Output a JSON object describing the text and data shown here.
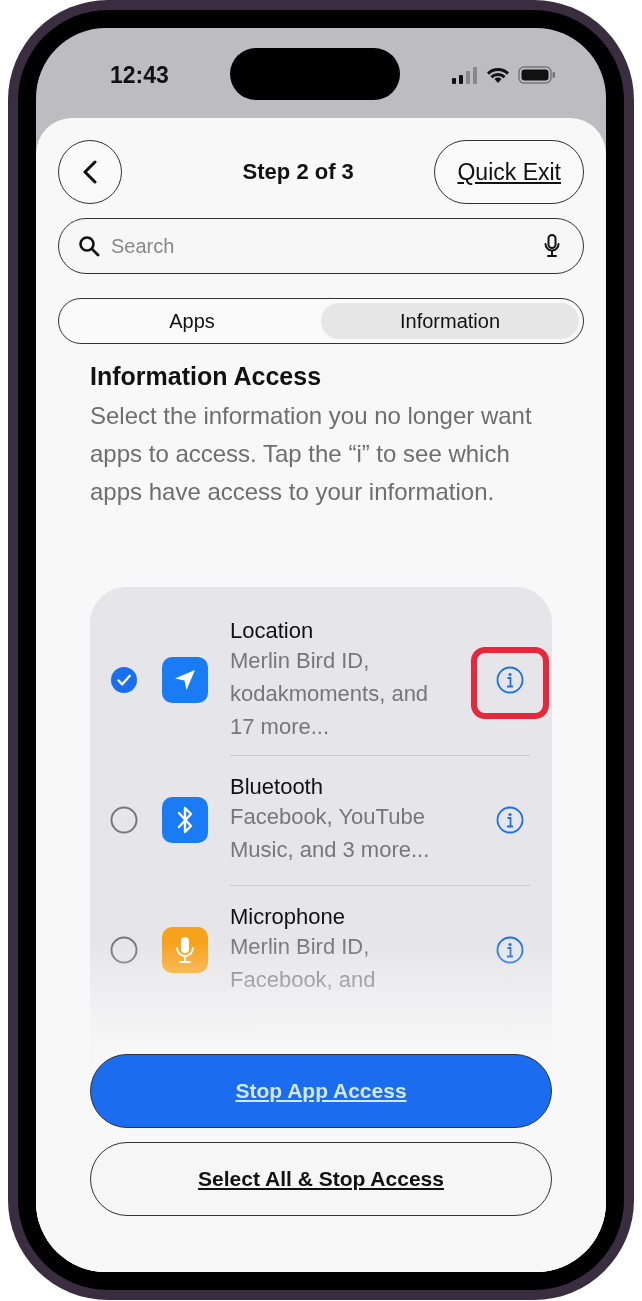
{
  "status_bar": {
    "time": "12:43"
  },
  "header": {
    "title": "Step 2 of 3",
    "quick_exit": "Quick Exit"
  },
  "search": {
    "placeholder": "Search"
  },
  "tabs": [
    {
      "label": "Apps",
      "selected": false
    },
    {
      "label": "Information",
      "selected": true
    }
  ],
  "section": {
    "title": "Information Access",
    "description": "Select the information you no longer want apps to access. Tap the “i” to see which apps have access to your information."
  },
  "items": [
    {
      "kind": "location",
      "title": "Location",
      "subtitle": "Merlin Bird ID, kodakmoments, and 17 more...",
      "checked": true,
      "highlighted": true
    },
    {
      "kind": "bluetooth",
      "title": "Bluetooth",
      "subtitle": "Facebook, YouTube Music, and 3 more...",
      "checked": false,
      "highlighted": false
    },
    {
      "kind": "microphone",
      "title": "Microphone",
      "subtitle": "Merlin Bird ID, Facebook, and",
      "checked": false,
      "highlighted": false
    }
  ],
  "buttons": [
    {
      "kind": "primary",
      "label": "Stop App Access"
    },
    {
      "kind": "secondary",
      "label": "Select All & Stop Access"
    }
  ]
}
